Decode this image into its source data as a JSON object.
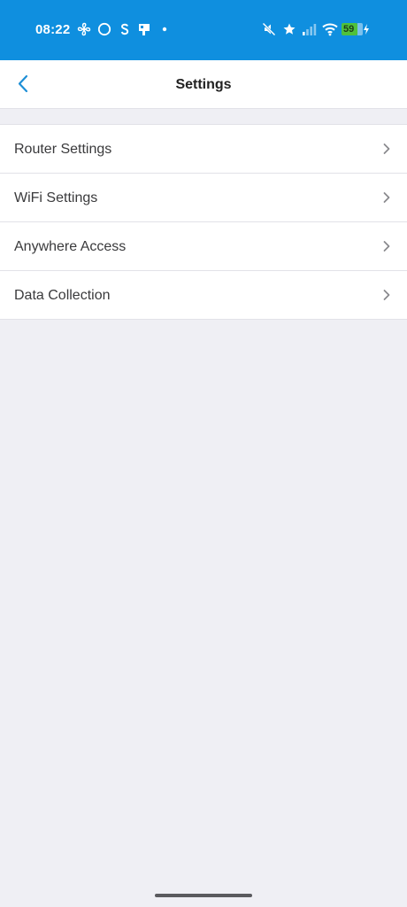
{
  "status_bar": {
    "time": "08:22",
    "battery": "59",
    "left_icons": [
      "fan-icon",
      "circle-icon",
      "s-icon",
      "notification-icon",
      "dot-icon"
    ],
    "right_icons": [
      "mute-icon",
      "star-icon",
      "signal-icon",
      "wifi-icon",
      "battery-icon",
      "charging-icon"
    ],
    "background": "#0f8fdf"
  },
  "nav": {
    "title": "Settings",
    "back_icon": "chevron-left-icon",
    "accent": "#1e8fd6"
  },
  "settings": {
    "items": [
      {
        "label": "Router Settings"
      },
      {
        "label": "WiFi Settings"
      },
      {
        "label": "Anywhere Access"
      },
      {
        "label": "Data Collection"
      }
    ]
  }
}
